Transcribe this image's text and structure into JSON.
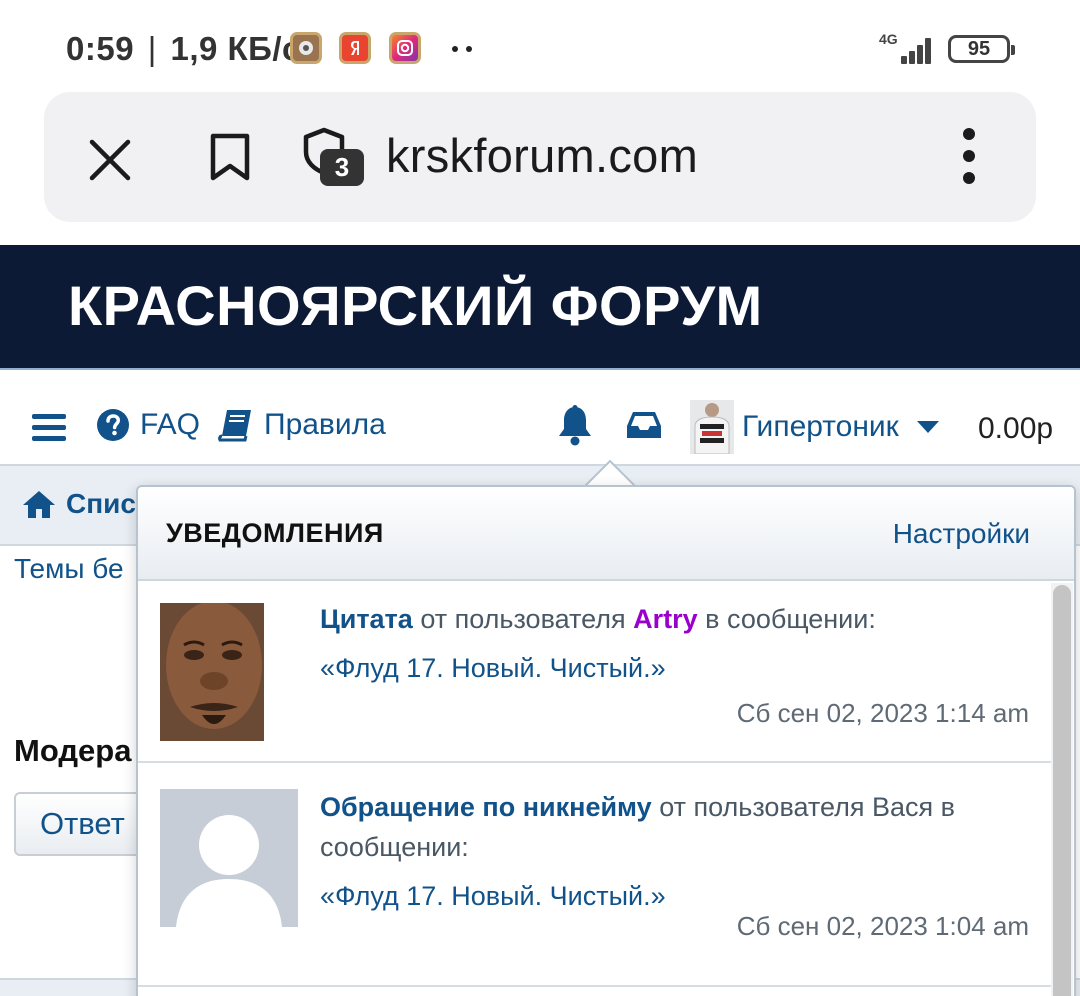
{
  "status_bar": {
    "time": "0:59",
    "separator": "|",
    "speed": "1,9 КБ/с",
    "app_icons": [
      "camera-app-icon",
      "yandex-app-icon",
      "instagram-app-icon"
    ],
    "network_type": "4G",
    "battery": "95"
  },
  "browser": {
    "url": "krskforum.com",
    "shield_count": "3"
  },
  "site": {
    "title": "КРАСНОЯРСКИЙ ФОРУМ"
  },
  "nav": {
    "faq": "FAQ",
    "rules": "Правила",
    "username": "Гипертоник",
    "balance": "0.00р"
  },
  "page": {
    "breadcrumb_home": "Спис",
    "topics_link": "Темы бе",
    "moderators": "Модера",
    "reply_button": "Ответ"
  },
  "notifications": {
    "title": "УВЕДОМЛЕНИЯ",
    "settings": "Настройки",
    "items": [
      {
        "type": "Цитата",
        "from_text": "от пользователя",
        "user": "Artry",
        "in_text": "в сообщении:",
        "topic": "«Флуд 17. Новый. Чистый.»",
        "time": "Сб сен 02, 2023 1:14 am"
      },
      {
        "type": "Обращение по никнейму",
        "from_text": "от пользователя",
        "user": "Вася",
        "in_text": "в сообщении:",
        "topic": "«Флуд 17. Новый. Чистый.»",
        "time": "Сб сен 02, 2023 1:04 am"
      }
    ]
  },
  "colors": {
    "header_bg": "#0c1a35",
    "link": "#105289",
    "user_color": "#9900cc"
  }
}
